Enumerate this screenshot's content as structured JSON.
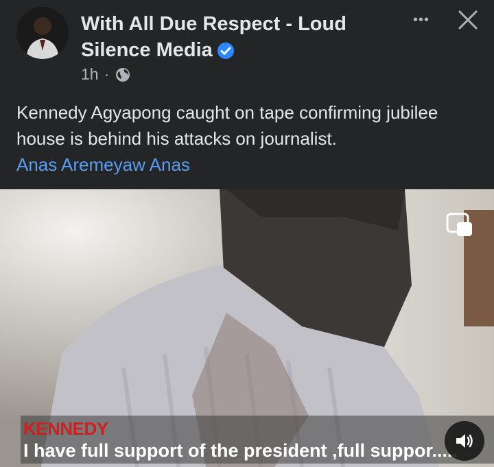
{
  "post": {
    "author": "With All Due Respect - Loud Silence Media",
    "time": "1h",
    "separator": "·",
    "privacy_icon": "globe-icon",
    "verified_icon": "verified-badge-icon",
    "text": "Kennedy Agyapong caught on tape confirming jubilee house is behind his attacks on journalist.",
    "tag": "Anas Aremeyaw Anas"
  },
  "header_actions": {
    "more_label": "•••",
    "close_icon": "close-icon"
  },
  "video": {
    "caption_name": "KENNEDY",
    "caption_text": "I have full support of the president ,full suppor.....",
    "sound_icon": "speaker-icon",
    "pip_icon": "picture-in-picture-icon"
  },
  "colors": {
    "background": "#242526",
    "text": "#e4e6eb",
    "secondary_text": "#b0b3b8",
    "link": "#5a9df7",
    "verified": "#2d88ff",
    "caption_name": "#d01f1f"
  }
}
